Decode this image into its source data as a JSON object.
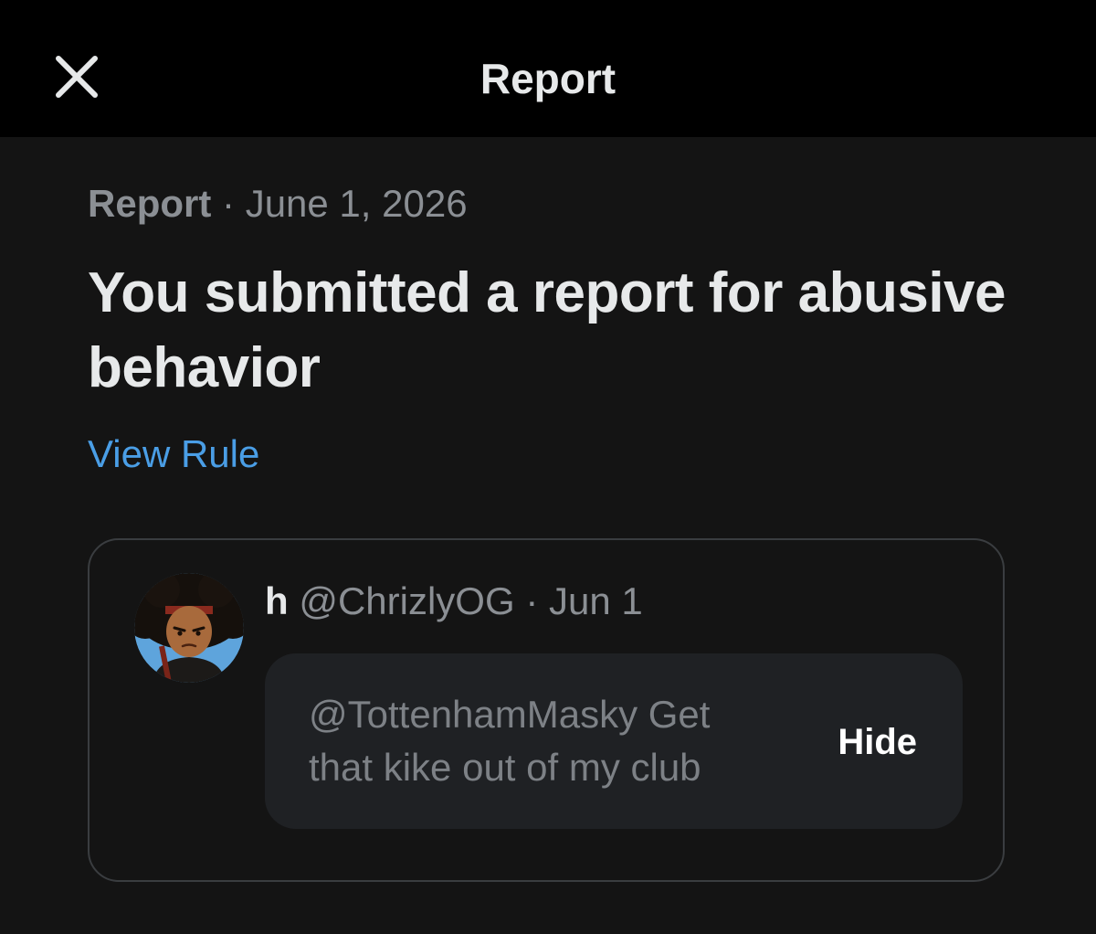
{
  "header": {
    "title": "Report",
    "close_icon": "close-icon"
  },
  "report": {
    "label": "Report",
    "separator": "·",
    "date": "June 1, 2026",
    "headline": "You submitted a report for abusive behavior",
    "view_rule_label": "View Rule"
  },
  "post": {
    "author_name": "h",
    "handle": "@ChrizlyOG",
    "separator": "·",
    "date": "Jun 1",
    "text": "@TottenhamMasky Get that kike out of my club",
    "hide_label": "Hide",
    "avatar_icon": "avatar-cartoon"
  },
  "colors": {
    "background": "#141414",
    "topbar": "#000000",
    "primary_text": "#e7e9ea",
    "secondary_text": "#8b8f94",
    "link": "#4a9ee6",
    "card_border": "#3a3d40",
    "hidden_bg": "#1f2124"
  }
}
